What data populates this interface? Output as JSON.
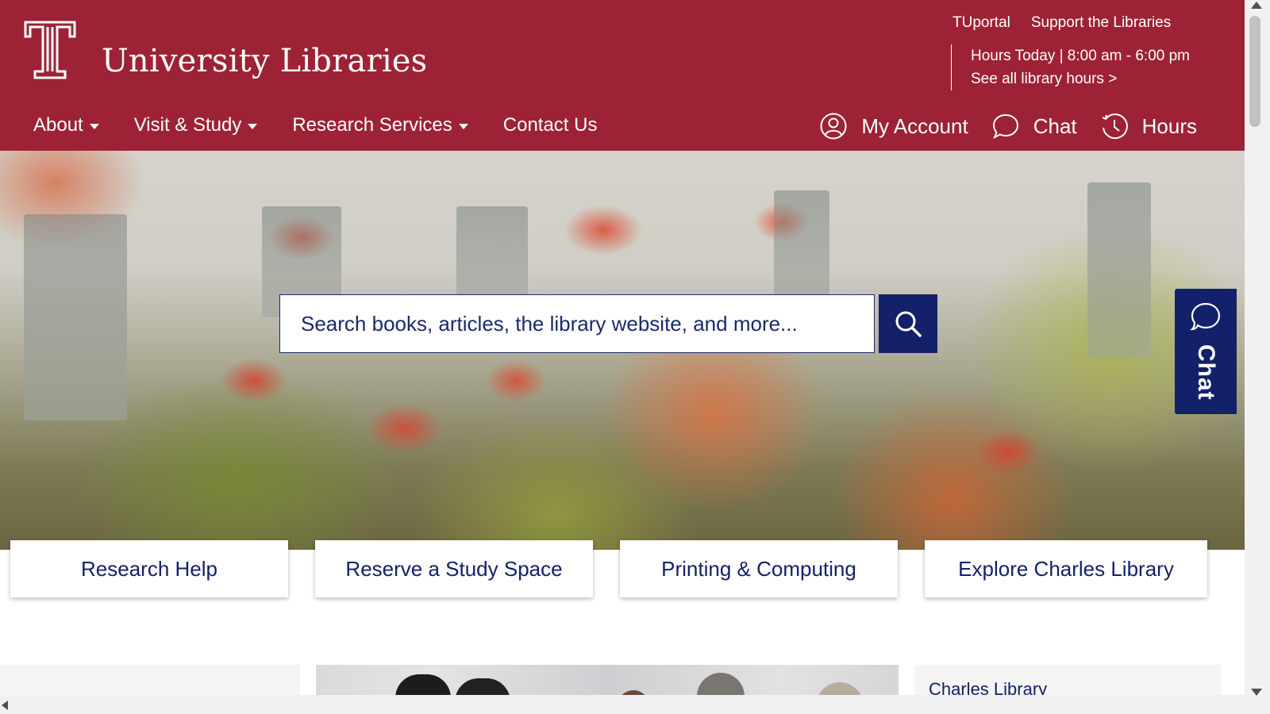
{
  "colors": {
    "brand": "#9d2235",
    "accent": "#13216b",
    "text_on_brand": "#ffffff"
  },
  "header": {
    "logo_icon": "temple-t-logo",
    "site_title": "University Libraries",
    "utility_links": [
      "TUportal",
      "Support the Libraries"
    ],
    "hours_today": "Hours Today | 8:00 am - 6:00 pm",
    "all_hours_link": "See all library hours >"
  },
  "nav": {
    "items": [
      {
        "label": "About",
        "dropdown": true
      },
      {
        "label": "Visit & Study",
        "dropdown": true
      },
      {
        "label": "Research Services",
        "dropdown": true
      },
      {
        "label": "Contact Us",
        "dropdown": false
      }
    ],
    "right": [
      {
        "label": "My Account",
        "icon": "user-icon"
      },
      {
        "label": "Chat",
        "icon": "chat-bubble-icon"
      },
      {
        "label": "Hours",
        "icon": "clock-icon"
      }
    ]
  },
  "search": {
    "placeholder": "Search books, articles, the library website, and more...",
    "button_icon": "search-icon"
  },
  "chat_tab": {
    "label": "Chat",
    "icon": "chat-bubble-icon"
  },
  "quick_links": [
    "Research Help",
    "Reserve a Study Space",
    "Printing & Computing",
    "Explore Charles Library"
  ],
  "bottom": {
    "right_heading": "Charles Library"
  }
}
